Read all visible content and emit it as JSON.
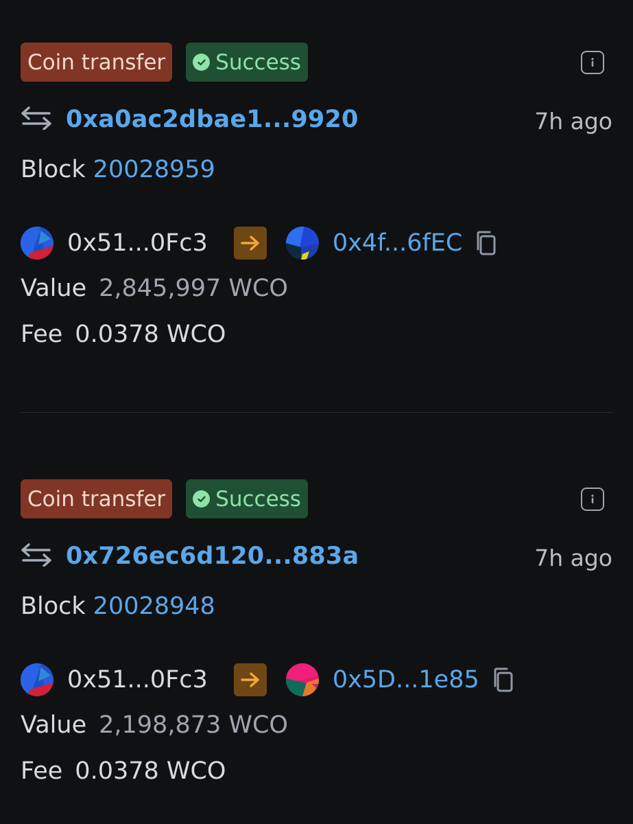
{
  "transactions": [
    {
      "type_label": "Coin transfer",
      "status_label": "Success",
      "hash": "0xa0ac2dbae1...9920",
      "time": "7h ago",
      "block_label": "Block",
      "block_number": "20028959",
      "from": "0x51...0Fc3",
      "to": "0x4f...6fEC",
      "value_label": "Value",
      "value": "2,845,997 WCO",
      "fee_label": "Fee",
      "fee": "0.0378 WCO"
    },
    {
      "type_label": "Coin transfer",
      "status_label": "Success",
      "hash": "0x726ec6d120...883a",
      "time": "7h ago",
      "block_label": "Block",
      "block_number": "20028948",
      "from": "0x51...0Fc3",
      "to": "0x5D...1e85",
      "value_label": "Value",
      "value": "2,198,873 WCO",
      "fee_label": "Fee",
      "fee": "0.0378 WCO"
    }
  ],
  "icons": {
    "status": "check-circle-icon",
    "info": "info-icon",
    "transfer": "swap-arrows-icon",
    "direction": "arrow-right-icon",
    "copy": "copy-icon"
  },
  "colors": {
    "background": "#101113",
    "link": "#5aa7ea",
    "type_badge": "#803525",
    "status_badge": "#1f5034",
    "success_text": "#8fe2a8",
    "direction_badge": "#6f4714"
  }
}
